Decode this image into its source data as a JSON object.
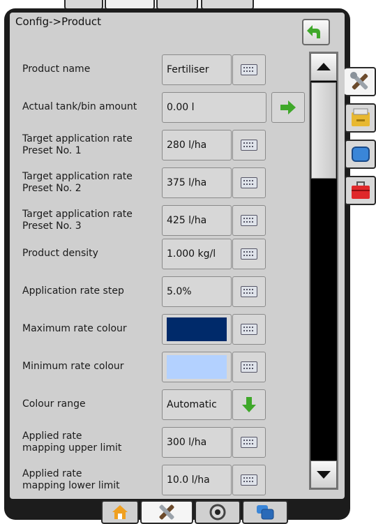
{
  "header": {
    "breadcrumb": "Config->Product"
  },
  "rows": [
    {
      "label": "Product name",
      "value": "Fertiliser"
    },
    {
      "label": "Actual tank/bin amount",
      "value": "0.00 l"
    },
    {
      "label": "Target application rate\nPreset No. 1",
      "value": "280 l/ha"
    },
    {
      "label": "Target application rate\nPreset No. 2",
      "value": "375 l/ha"
    },
    {
      "label": "Target application rate\nPreset No. 3",
      "value": "425 l/ha"
    },
    {
      "label": "Product density",
      "value": "1.000 kg/l"
    },
    {
      "label": "Application rate step",
      "value": "5.0%"
    },
    {
      "label": "Maximum rate colour",
      "color": "#002a6a"
    },
    {
      "label": "Minimum rate colour",
      "color": "#b3d1ff"
    },
    {
      "label": "Colour range",
      "value": "Automatic"
    },
    {
      "label": "Applied rate\nmapping upper limit",
      "value": "300 l/ha"
    },
    {
      "label": "Applied rate\nmapping lower limit",
      "value": "10.0 l/ha"
    }
  ],
  "colors": {
    "accent_green": "#3fa82a",
    "panel_bg": "#cfcfcf",
    "frame": "#1c1c1c"
  },
  "icons": {
    "back": "back-arrow-icon",
    "keyboard": "keyboard-icon",
    "next": "right-arrow-icon",
    "dropdown": "down-arrow-icon",
    "scroll_up": "up-triangle-icon",
    "scroll_down": "down-triangle-icon",
    "side_tabs": [
      "tools-icon",
      "console-icon",
      "display-icon",
      "toolbox-icon"
    ],
    "bottom_tabs": [
      "home-icon",
      "tools-icon",
      "gps-icon",
      "window-icon"
    ]
  }
}
